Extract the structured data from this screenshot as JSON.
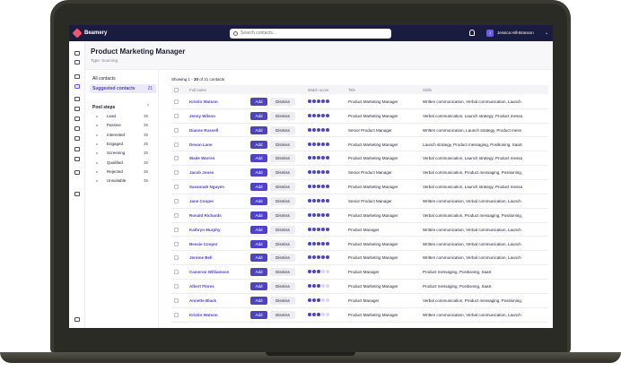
{
  "app": {
    "brand": "Beamery",
    "user_initials": "J",
    "user_name": "Jessica Hill-Branson"
  },
  "search": {
    "placeholder": "Search contacts..."
  },
  "header": {
    "title": "Product Marketing Manager",
    "subtitle": "Type: Sourcing"
  },
  "panel": {
    "all_contacts": "All contacts",
    "suggested": {
      "label": "Suggested contacts",
      "count": "21"
    },
    "pool_title": "Pool steps",
    "steps": [
      {
        "label": "Lead",
        "count": "35"
      },
      {
        "label": "Passive",
        "count": "35"
      },
      {
        "label": "Interested",
        "count": "35"
      },
      {
        "label": "Engaged",
        "count": "35"
      },
      {
        "label": "Screening",
        "count": "35"
      },
      {
        "label": "Qualified",
        "count": "35"
      },
      {
        "label": "Rejected",
        "count": "35"
      },
      {
        "label": "Unsuitable",
        "count": "35"
      }
    ]
  },
  "table": {
    "showing_prefix": "Showing 1 - ",
    "showing_bold": "20",
    "showing_suffix": " of 21 contacts",
    "columns": {
      "name": "Full name",
      "score": "Match score",
      "title": "Title",
      "skills": "Skills"
    },
    "add_label": "Add",
    "dismiss_label": "Dismiss",
    "rows": [
      {
        "name": "Kristin Watson",
        "score": 5,
        "title": "Product Marketing Manager",
        "skills": "Written communication, Verbal communication, Launch"
      },
      {
        "name": "Jenny Wilson",
        "score": 5,
        "title": "Product Marketing Manager",
        "skills": "Verbal communication, Launch strategy, Product messa"
      },
      {
        "name": "Dianne Russell",
        "score": 5,
        "title": "Senior Product Manager",
        "skills": "Written communication, Launch strategy, Product mess"
      },
      {
        "name": "Devon Lane",
        "score": 5,
        "title": "Product Marketing Manager",
        "skills": "Launch strategy, Product messaging, Positioning, SaaS"
      },
      {
        "name": "Wade Warren",
        "score": 5,
        "title": "Product Marketing Manager",
        "skills": "Verbal communication, Launch strategy, Product messa"
      },
      {
        "name": "Jacob Jones",
        "score": 5,
        "title": "Senior Product Manager",
        "skills": "Verbal communication, Product messaging, Positioning,"
      },
      {
        "name": "Savannah Nguyen",
        "score": 5,
        "title": "Product Marketing Manager",
        "skills": "Verbal communication, Launch strategy, Product messa"
      },
      {
        "name": "Jane Cooper",
        "score": 5,
        "title": "Senior Product Manager",
        "skills": "Written communication, Verbal communication, Launch"
      },
      {
        "name": "Ronald Richards",
        "score": 5,
        "title": "Product Marketing Manager",
        "skills": "Verbal communication, Product messaging, Positioning,"
      },
      {
        "name": "Kathryn Murphy",
        "score": 5,
        "title": "Product Manager",
        "skills": "Written communication, Verbal communication, Launch"
      },
      {
        "name": "Bessie Cooper",
        "score": 5,
        "title": "Product Marketing Manager",
        "skills": "Written communication, Verbal communication, Launch"
      },
      {
        "name": "Jerome Bell",
        "score": 5,
        "title": "Product Marketing Manager",
        "skills": "Written communication, Verbal communication, Launch"
      },
      {
        "name": "Cameron Williamson",
        "score": 3,
        "title": "Product Manager",
        "skills": "Product messaging, Positioning, SaaS"
      },
      {
        "name": "Albert Flores",
        "score": 3,
        "title": "Product Marketing Manager",
        "skills": "Product messaging, Positioning, SaaS"
      },
      {
        "name": "Annette Black",
        "score": 3,
        "title": "Product Manager",
        "skills": "Verbal communication, Product messaging, Positioning,"
      },
      {
        "name": "Kristin Watson",
        "score": 3,
        "title": "Product Marketing Manager",
        "skills": "Written communication, Verbal communication, Launch"
      }
    ]
  },
  "colors": {
    "accent": "#4f43c4",
    "topbar": "#191b3f",
    "brand": "#f2546b"
  },
  "rail_icons": [
    "home-icon",
    "recent-icon",
    "contacts-icon",
    "folder-icon",
    "inbox-icon",
    "mail-icon",
    "calendar-icon",
    "users-icon",
    "workflow-icon",
    "filter-icon",
    "schedule-icon",
    "analytics-icon",
    "automation-icon",
    "collapse-icon"
  ]
}
